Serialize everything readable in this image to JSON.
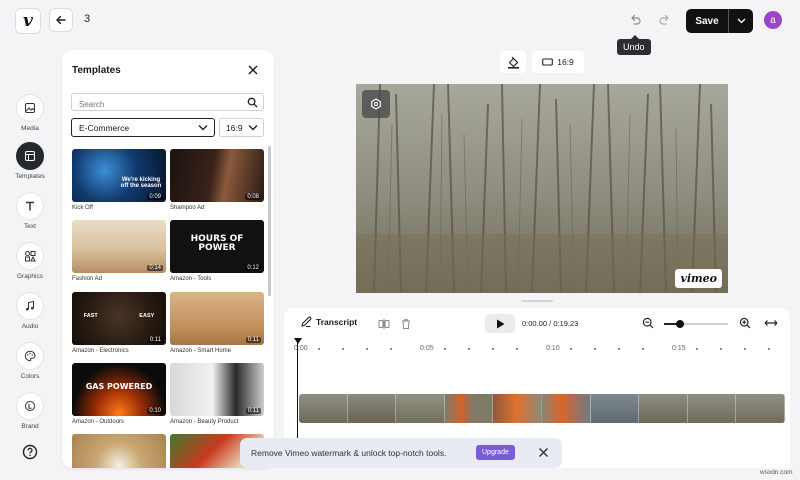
{
  "topbar": {
    "logo": "v",
    "project_name": "3",
    "save_label": "Save",
    "avatar_initial": "a",
    "tooltip": "Undo"
  },
  "rail": [
    {
      "label": "Media",
      "icon": "image-icon"
    },
    {
      "label": "Templates",
      "icon": "templates-icon",
      "active": true
    },
    {
      "label": "Text",
      "icon": "text-icon"
    },
    {
      "label": "Graphics",
      "icon": "graphics-icon"
    },
    {
      "label": "Audio",
      "icon": "music-note-icon"
    },
    {
      "label": "Colors",
      "icon": "palette-icon"
    },
    {
      "label": "Brand",
      "icon": "brand-icon"
    }
  ],
  "templates_panel": {
    "title": "Templates",
    "search_placeholder": "Search",
    "category": "E-Commerce",
    "ratio": "16:9",
    "items": [
      {
        "name": "Kick Off",
        "duration": "0:09",
        "thumb_text": "We're kicking off the season"
      },
      {
        "name": "Shampoo Ad",
        "duration": "0:08",
        "thumb_text": ""
      },
      {
        "name": "Fashion Ad",
        "duration": "0:14",
        "thumb_text": ""
      },
      {
        "name": "Amazon - Tools",
        "duration": "0:12",
        "thumb_text": "HOURS OF POWER"
      },
      {
        "name": "Amazon - Electronics",
        "duration": "0:11",
        "thumb_text": "FAST  EASY"
      },
      {
        "name": "Amazon - Smart Home",
        "duration": "0:11",
        "thumb_text": ""
      },
      {
        "name": "Amazon - Outdoors",
        "duration": "0:10",
        "thumb_text": "GAS POWERED"
      },
      {
        "name": "Amazon - Beauty Product",
        "duration": "0:11",
        "thumb_text": ""
      }
    ]
  },
  "preview_toolbar": {
    "ratio_label": "16:9"
  },
  "preview": {
    "watermark": "vimeo"
  },
  "timeline": {
    "transcript_label": "Transcript",
    "time_current": "0:00.00",
    "time_separator": "/",
    "time_total": "0:19.23",
    "zoom_level": 0.25,
    "ruler_labels": [
      "0:00",
      "0:05",
      "0:10",
      "0:15"
    ]
  },
  "banner": {
    "text": "Remove Vimeo watermark & unlock top-notch tools.",
    "upgrade_label": "Upgrade"
  },
  "site_mark": "wsxdn.com",
  "colors": {
    "accent": "#7a5cd8",
    "avatar": "#9b46c9",
    "save_bg": "#111111"
  }
}
